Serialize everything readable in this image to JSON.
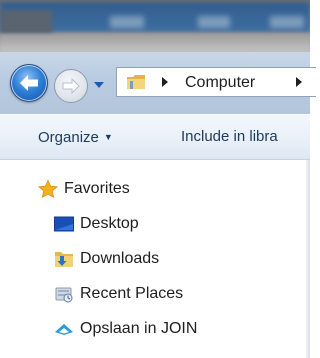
{
  "address_bar": {
    "path": [
      "Computer"
    ]
  },
  "command_bar": {
    "organize_label": "Organize",
    "include_label": "Include in libra"
  },
  "navigation_pane": {
    "favorites_label": "Favorites",
    "items": [
      {
        "label": "Desktop",
        "icon": "desktop-icon"
      },
      {
        "label": "Downloads",
        "icon": "downloads-folder-icon"
      },
      {
        "label": "Recent Places",
        "icon": "recent-places-icon"
      },
      {
        "label": "Opslaan in JOIN",
        "icon": "cloud-icon"
      }
    ]
  },
  "colors": {
    "navbar_bg": "#b8cbe0",
    "back_button": "#2f7fd6",
    "cmd_text": "#1e395b",
    "favorites_star": "#f2b21c",
    "folder_yellow": "#e8c25a"
  }
}
